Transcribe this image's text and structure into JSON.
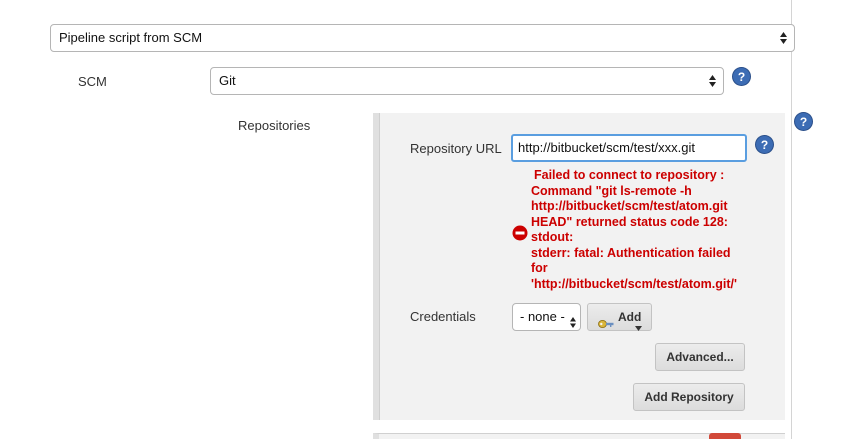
{
  "definition": {
    "selected": "Pipeline script from SCM"
  },
  "scm": {
    "label": "SCM",
    "selected": "Git"
  },
  "repositories": {
    "label": "Repositories",
    "url_label": "Repository URL",
    "url_value": "http://bitbucket/scm/test/xxx.git",
    "error_lines": [
      "Failed to connect to repository :",
      "Command \"git ls-remote -h",
      "http://bitbucket/scm/test/atom.git",
      "HEAD\" returned status code 128:",
      "stdout:",
      "stderr: fatal: Authentication failed",
      "for",
      "'http://bitbucket/scm/test/atom.git/'"
    ],
    "credentials_label": "Credentials",
    "credentials_selected": "- none -",
    "add_label": "Add",
    "advanced_label": "Advanced...",
    "add_repository_label": "Add Repository"
  },
  "colors": {
    "error": "#cc0000",
    "help_icon": "#3c6cb4",
    "focus_border": "#5a9ee0",
    "delete_button": "#d24939"
  },
  "icons": {
    "help": "question-circle",
    "error": "minus-circle",
    "key": "key",
    "dropdown": "chevron-up-down"
  }
}
